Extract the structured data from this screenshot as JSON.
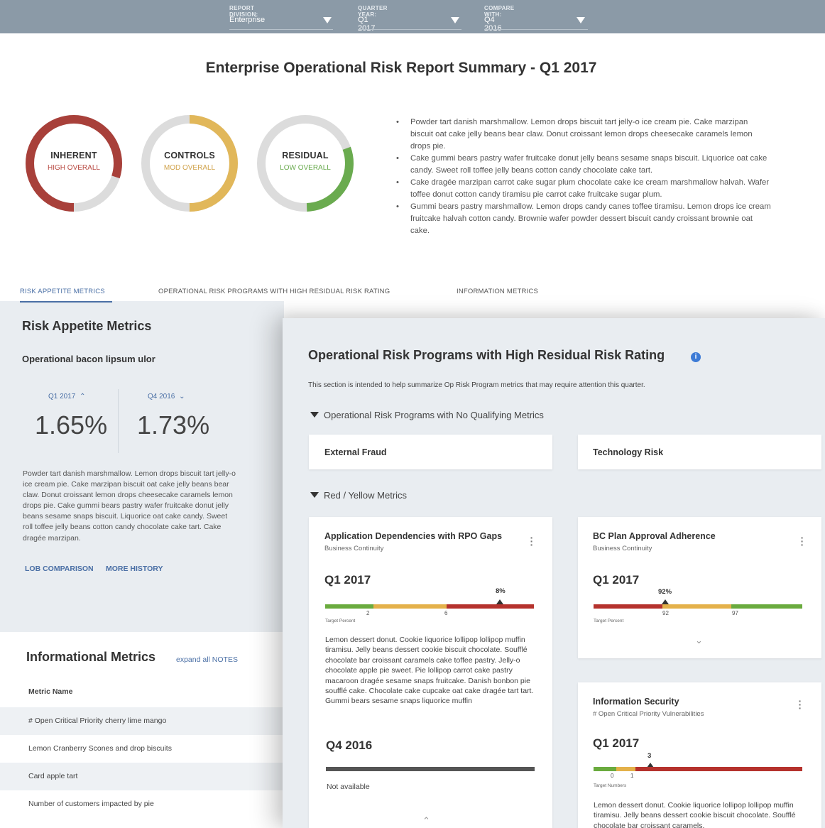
{
  "filters": [
    {
      "label": "REPORT DIVISION:",
      "value": "Enterprise"
    },
    {
      "label": "QUARTER YEAR:",
      "value": "Q1 2017"
    },
    {
      "label": "COMPARE WITH:",
      "value": "Q4 2016"
    }
  ],
  "page_title": "Enterprise Operational Risk Report Summary - Q1 2017",
  "donuts": [
    {
      "title": "INHERENT",
      "rating": "HIGH OVERALL",
      "color": "#a8403a",
      "level": 0.8
    },
    {
      "title": "CONTROLS",
      "rating": "MOD OVERALL",
      "color": "#e1b75a",
      "level": 0.5
    },
    {
      "title": "RESIDUAL",
      "rating": "LOW OVERALL",
      "color": "#6aab4f",
      "level": 0.3
    }
  ],
  "summary_bullets": [
    "Powder tart danish marshmallow. Lemon drops biscuit tart jelly-o ice cream pie. Cake marzipan biscuit oat cake jelly beans bear claw. Donut croissant lemon drops cheesecake caramels lemon drops pie.",
    "Cake gummi bears pastry wafer fruitcake donut jelly beans sesame snaps biscuit. Liquorice oat cake candy. Sweet roll toffee jelly beans cotton candy chocolate cake tart.",
    "Cake dragée marzipan carrot cake sugar plum chocolate cake ice cream marshmallow halvah. Wafer toffee donut cotton candy tiramisu pie carrot cake fruitcake sugar plum.",
    "Gummi bears pastry marshmallow. Lemon drops candy canes toffee tiramisu. Lemon drops ice cream fruitcake halvah cotton candy. Brownie wafer powder dessert biscuit candy croissant brownie oat cake."
  ],
  "tabs": [
    {
      "label": "RISK APPETITE METRICS",
      "active": true
    },
    {
      "label": "OPERATIONAL RISK PROGRAMS WITH HIGH RESIDUAL RISK RATING",
      "active": false
    },
    {
      "label": "INFORMATION METRICS",
      "active": false
    }
  ],
  "risk_appetite": {
    "title": "Risk Appetite Metrics",
    "subtitle": "Operational bacon lipsum ulor",
    "current": {
      "label": "Q1 2017",
      "value": "1.65%"
    },
    "compare": {
      "label": "Q4 2016",
      "value": "1.73%"
    },
    "description": "Powder tart danish marshmallow. Lemon drops biscuit tart jelly-o ice cream pie. Cake marzipan biscuit oat cake jelly beans bear claw. Donut croissant lemon drops cheesecake caramels lemon drops pie. Cake gummi bears pastry wafer fruitcake donut jelly beans sesame snaps biscuit. Liquorice oat cake candy. Sweet roll toffee jelly beans cotton candy chocolate cake tart. Cake dragée marzipan.",
    "link_lob": "LOB COMPARISON",
    "link_history": "MORE HISTORY"
  },
  "informational": {
    "title": "Informational Metrics",
    "expand_link": "expand all NOTES",
    "column_header": "Metric Name",
    "rows": [
      "# Open Critical Priority cherry lime mango",
      "Lemon Cranberry Scones and drop biscuits",
      "Card apple tart",
      "Number of customers impacted by pie"
    ]
  },
  "programs": {
    "title": "Operational Risk Programs with High Residual Risk Rating",
    "info_icon": "i",
    "description": "This section is intended to help summarize Op Risk Program metrics that may require attention this quarter.",
    "no_qualifying_title": "Operational Risk Programs with No Qualifying Metrics",
    "no_qualifying": [
      "External Fraud",
      "Technology Risk"
    ],
    "red_yellow_title": "Red / Yellow Metrics",
    "cards": [
      {
        "name": "Application Dependencies with RPO Gaps",
        "category": "Business Continuity",
        "period": "Q1 2017",
        "value_label": "8%",
        "value": 8,
        "ticks": [
          "2",
          "6"
        ],
        "target_label": "Target Percent",
        "notes": "Lemon dessert donut. Cookie liquorice lollipop lollipop muffin tiramisu. Jelly beans dessert cookie biscuit chocolate. Soufflé chocolate bar croissant caramels cake toffee pastry. Jelly-o chocolate apple pie sweet. Pie lollipop carrot cake pastry macaroon dragée sesame snaps fruitcake. Danish bonbon pie soufflé cake. Chocolate cake cupcake oat cake dragée tart tart. Gummi bears sesame snaps liquorice muffin",
        "compare_period": "Q4 2016",
        "compare_value": "Not available"
      },
      {
        "name": "BC Plan Approval Adherence",
        "category": "Business Continuity",
        "period": "Q1 2017",
        "value_label": "92%",
        "value": 92,
        "ticks": [
          "92",
          "97"
        ],
        "target_label": "Target Percent"
      },
      {
        "name": "Information Security",
        "category": "# Open Critical Priority Vulnerabilities",
        "period": "Q1 2017",
        "value_label": "3",
        "value": 3,
        "ticks": [
          "0",
          "1"
        ],
        "target_label": "Target Numbers",
        "notes": "Lemon dessert donut. Cookie liquorice lollipop lollipop muffin tiramisu. Jelly beans dessert cookie biscuit chocolate. Soufflé chocolate bar croissant caramels."
      }
    ]
  },
  "colors": {
    "red": "#b5322d",
    "yellow": "#e4b14a",
    "green": "#6aab3e",
    "accent": "#4a6fa5"
  }
}
